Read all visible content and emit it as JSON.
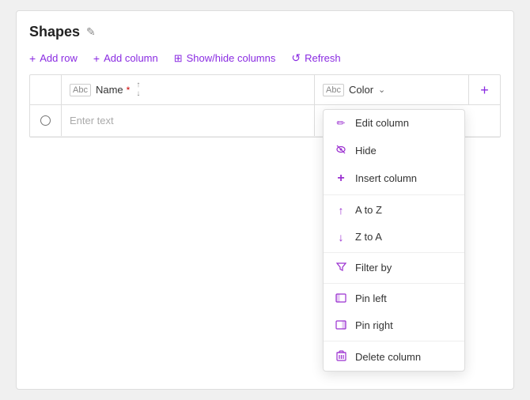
{
  "panel": {
    "title": "Shapes",
    "edit_tooltip": "Edit"
  },
  "toolbar": {
    "add_row": "Add row",
    "add_column": "Add column",
    "show_hide": "Show/hide columns",
    "refresh": "Refresh"
  },
  "table": {
    "columns": [
      {
        "id": "name",
        "type_icon": "Abc",
        "label": "Name",
        "required": true
      },
      {
        "id": "color",
        "type_icon": "Abc",
        "label": "Color",
        "required": false
      }
    ],
    "rows": [
      {
        "name_placeholder": "Enter text",
        "color_value": ""
      }
    ],
    "add_column_label": "+"
  },
  "dropdown": {
    "items": [
      {
        "id": "edit-column",
        "icon": "✏️",
        "label": "Edit column"
      },
      {
        "id": "hide",
        "icon": "👁️",
        "label": "Hide"
      },
      {
        "id": "insert-column",
        "icon": "+",
        "label": "Insert column"
      },
      {
        "id": "a-to-z",
        "icon": "↑",
        "label": "A to Z"
      },
      {
        "id": "z-to-a",
        "icon": "↓",
        "label": "Z to A"
      },
      {
        "id": "filter-by",
        "icon": "▽",
        "label": "Filter by"
      },
      {
        "id": "pin-left",
        "icon": "▭",
        "label": "Pin left"
      },
      {
        "id": "pin-right",
        "icon": "▭",
        "label": "Pin right"
      },
      {
        "id": "delete-column",
        "icon": "🗑️",
        "label": "Delete column"
      }
    ]
  },
  "icons": {
    "edit": "✎",
    "plus": "+",
    "refresh": "↺",
    "up_arrow": "↑",
    "down_arrow": "↓",
    "chevron_down": "⌄"
  }
}
